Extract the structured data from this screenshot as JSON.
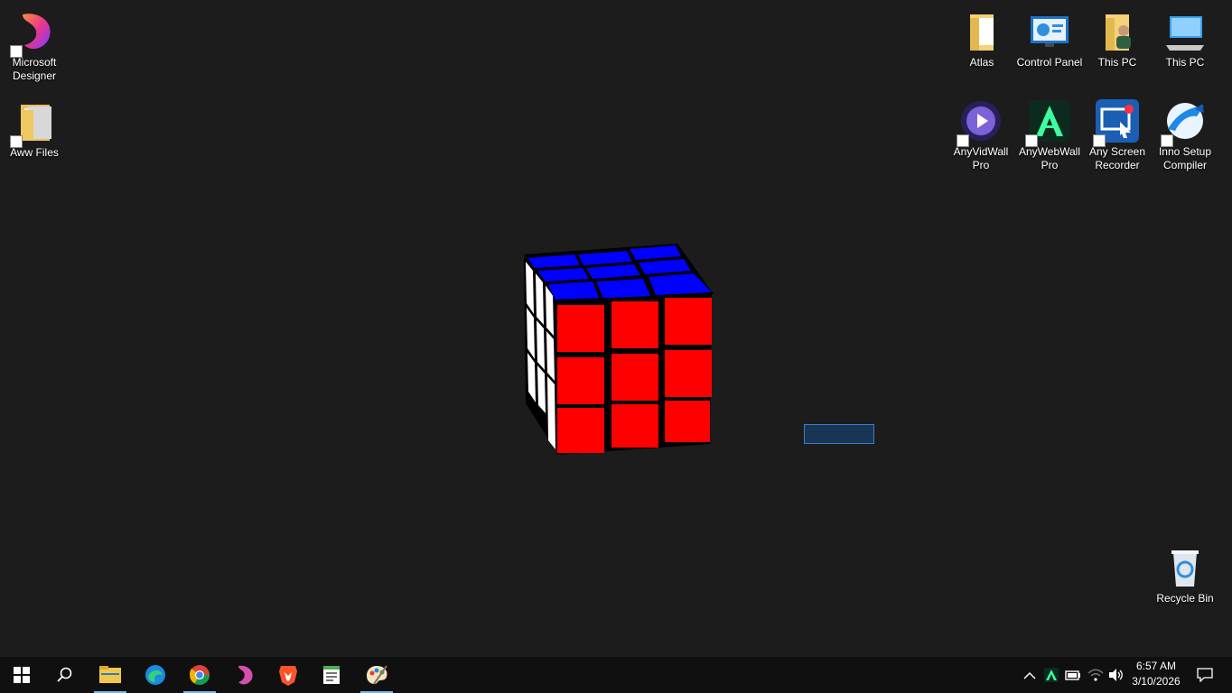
{
  "desktop": {
    "icons": [
      {
        "label": "Microsoft Designer",
        "icon": "designer-icon"
      },
      {
        "label": "Aww Files",
        "icon": "folder-icon"
      },
      {
        "label": "Atlas",
        "icon": "folder-icon"
      },
      {
        "label": "Control Panel",
        "icon": "control-panel-icon"
      },
      {
        "label": "This PC",
        "icon": "user-folder-icon"
      },
      {
        "label": "This PC",
        "icon": "computer-icon"
      },
      {
        "label": "AnyVidWall Pro",
        "icon": "anyvidwall-icon"
      },
      {
        "label": "AnyWebWall Pro",
        "icon": "anywebwall-icon"
      },
      {
        "label": "Any Screen Recorder",
        "icon": "screen-recorder-icon"
      },
      {
        "label": "Inno Setup Compiler",
        "icon": "inno-setup-icon"
      },
      {
        "label": "Recycle Bin",
        "icon": "recycle-bin-icon"
      }
    ]
  },
  "cube": {
    "top_color": "#0000ff",
    "front_color": "#ff0000",
    "side_color": "#ffffff",
    "gap_color": "#000000"
  },
  "taskbar": {
    "apps": [
      {
        "icon": "windows-start-icon"
      },
      {
        "icon": "search-icon"
      },
      {
        "icon": "file-explorer-icon"
      },
      {
        "icon": "edge-icon"
      },
      {
        "icon": "chrome-icon"
      },
      {
        "icon": "designer-icon"
      },
      {
        "icon": "brave-icon"
      },
      {
        "icon": "notepad-icon"
      },
      {
        "icon": "paint-icon"
      }
    ],
    "tray": [
      "chevron-up-icon",
      "anywebwall-tray-icon",
      "battery-icon",
      "wifi-icon",
      "volume-icon"
    ],
    "time": "6:57 AM",
    "date": "3/10/2026"
  }
}
